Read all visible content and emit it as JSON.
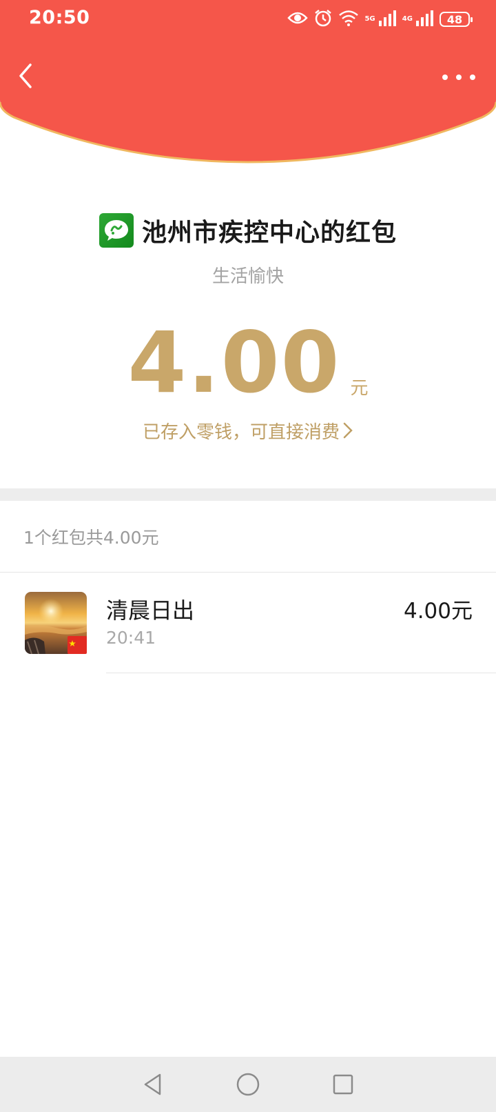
{
  "status_bar": {
    "time": "20:50",
    "net1": "5G",
    "net2": "4G",
    "battery": "48",
    "icons": [
      "eye-icon",
      "alarm-icon",
      "wifi-icon",
      "signal-5g-icon",
      "signal-4g-icon",
      "battery-icon"
    ]
  },
  "header": {
    "back_icon": "chevron-left-icon",
    "more_icon": "more-dots-icon",
    "color": "#f5564a",
    "arc_border_color": "#f0b860"
  },
  "envelope": {
    "sender": "池州市疾控中心的红包",
    "blessing": "生活愉快",
    "amount": "4.00",
    "unit": "元",
    "wallet_text": "已存入零钱，可直接消费",
    "accent_color": "#c9a76a"
  },
  "summary": "1个红包共4.00元",
  "records": [
    {
      "name": "清晨日出",
      "time": "20:41",
      "amount": "4.00元"
    }
  ],
  "nav": {
    "back_icon": "triangle-back-icon",
    "home_icon": "circle-home-icon",
    "recent_icon": "square-recent-icon"
  }
}
